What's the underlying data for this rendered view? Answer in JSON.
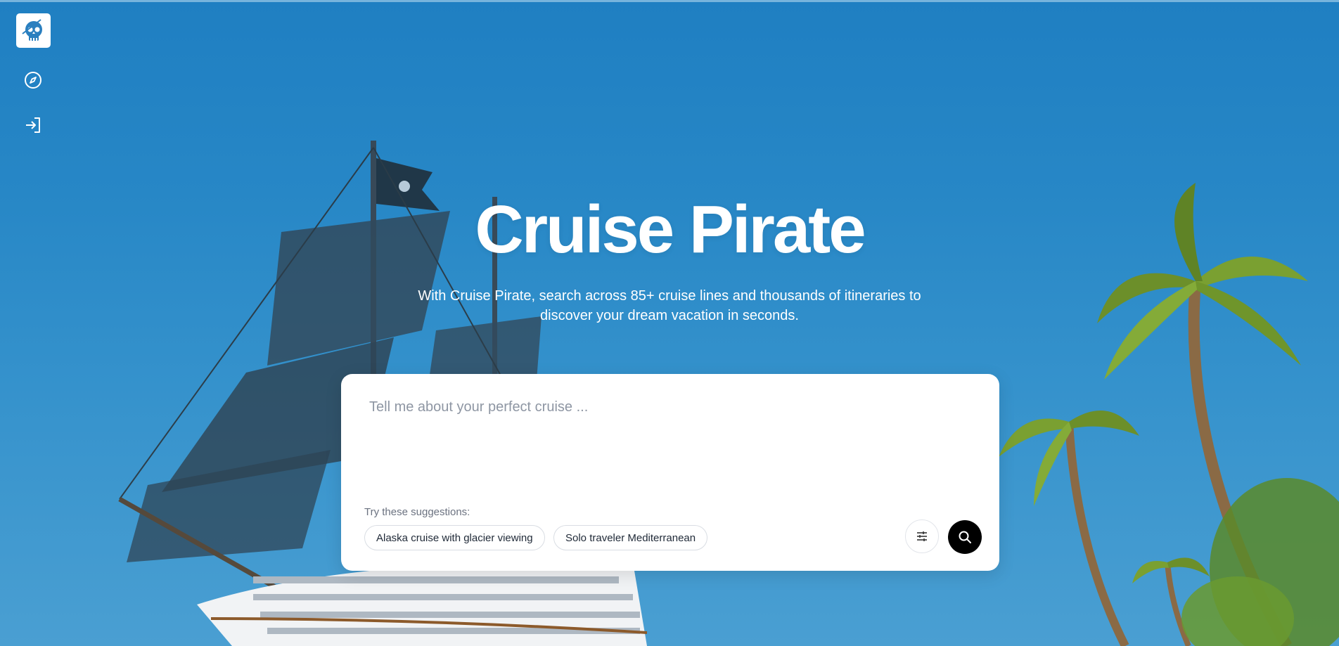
{
  "brand": {
    "title": "Cruise Pirate",
    "subtitle": "With Cruise Pirate, search across 85+ cruise lines and thousands of itineraries to discover your dream vacation in seconds.",
    "logo_icon": "pirate-skull-icon"
  },
  "sidebar": {
    "items": [
      {
        "icon": "compass-icon"
      },
      {
        "icon": "sign-in-icon"
      }
    ]
  },
  "search": {
    "placeholder": "Tell me about your perfect cruise ...",
    "value": "",
    "suggestions_label": "Try these suggestions:",
    "suggestions": [
      "Alaska cruise with glacier viewing",
      "Solo traveler Mediterranean"
    ],
    "filter_icon": "sliders-icon",
    "search_icon": "search-icon"
  },
  "colors": {
    "sky": "#2787c6",
    "card": "#ffffff",
    "search_button": "#000000"
  }
}
